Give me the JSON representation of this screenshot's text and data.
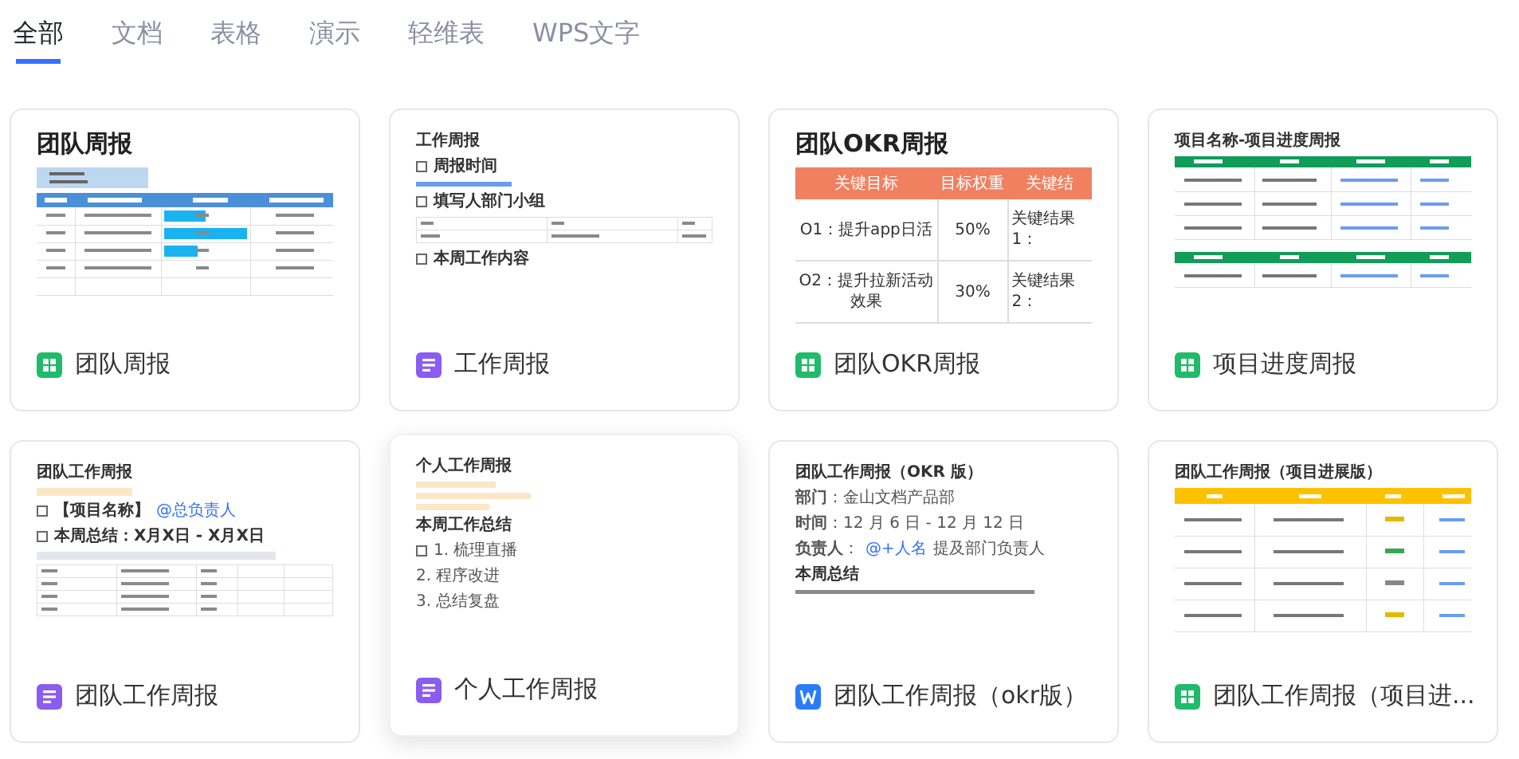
{
  "tabs": [
    {
      "label": "全部",
      "selected": true
    },
    {
      "label": "文档",
      "selected": false
    },
    {
      "label": "表格",
      "selected": false
    },
    {
      "label": "演示",
      "selected": false
    },
    {
      "label": "轻维表",
      "selected": false
    },
    {
      "label": "WPS文字",
      "selected": false
    }
  ],
  "cards": [
    {
      "name": "团队周报",
      "kind": "sheet",
      "hovered": false,
      "preview": [
        {
          "kind": "title",
          "text": "团队周报"
        },
        {
          "kind": "progress_table"
        }
      ]
    },
    {
      "name": "工作周报",
      "kind": "doc",
      "hovered": false,
      "preview": [
        {
          "kind": "subtitle",
          "text": "工作周报"
        },
        {
          "kind": "heading",
          "text": "周报时间",
          "box": true
        },
        {
          "kind": "blue_line"
        },
        {
          "kind": "heading",
          "text": "填写人部门小组",
          "box": true
        },
        {
          "kind": "small_table"
        },
        {
          "kind": "heading",
          "text": "本周工作内容",
          "box": true
        }
      ]
    },
    {
      "name": "团队OKR周报",
      "kind": "sheet",
      "hovered": false,
      "preview": [
        {
          "kind": "title",
          "text": "团队OKR周报"
        },
        {
          "kind": "table",
          "color": "#f08060",
          "columns": [
            "关键目标",
            "目标权重",
            "关键结"
          ],
          "rows": [
            [
              "O1：提升app日活",
              "50%",
              "关键结果1："
            ],
            [
              "O2：提升拉新活动效果",
              "30%",
              "关键结果2："
            ]
          ]
        }
      ]
    },
    {
      "name": "项目进度周报",
      "kind": "sheet",
      "hovered": false,
      "preview": [
        {
          "kind": "subtitle",
          "text": "项目名称-项目进度周报"
        },
        {
          "kind": "green_tables"
        }
      ]
    },
    {
      "name": "团队工作周报",
      "kind": "doc",
      "hovered": false,
      "preview": [
        {
          "kind": "subtitle",
          "text": "团队工作周报"
        },
        {
          "kind": "highlight_bar"
        },
        {
          "kind": "heading",
          "text": "【项目名称】",
          "link": "@总负责人",
          "box": true
        },
        {
          "kind": "heading",
          "text": "本周总结：X月X日 - X月X日",
          "box": true
        },
        {
          "kind": "grey_bar"
        },
        {
          "kind": "five_column_table"
        }
      ]
    },
    {
      "name": "个人工作周报",
      "kind": "doc",
      "hovered": true,
      "preview": [
        {
          "kind": "subtitle",
          "text": "个人工作周报"
        },
        {
          "kind": "highlight_bars"
        },
        {
          "kind": "heading",
          "text": "本周工作总结",
          "box": false
        },
        {
          "kind": "line",
          "text": "1. 梳理直播",
          "box": true
        },
        {
          "kind": "line",
          "text": "2. 程序改进",
          "box": false
        },
        {
          "kind": "line",
          "text": "3. 总结复盘",
          "box": false
        }
      ]
    },
    {
      "name": "团队工作周报（okr版）",
      "kind": "word",
      "hovered": false,
      "preview": [
        {
          "kind": "subtitle",
          "text": "团队工作周报（OKR 版）"
        },
        {
          "kind": "line",
          "text": "**部门**：金山文档产品部",
          "box": false
        },
        {
          "kind": "line",
          "text": "**时间**：12 月 6 日 - 12 月 12 日",
          "box": false
        },
        {
          "kind": "line",
          "text": "**负责人**：",
          "link": "@+人名",
          "after": "提及部门负责人",
          "box": false
        },
        {
          "kind": "heading",
          "text": "本周总结",
          "box": false
        },
        {
          "kind": "text_line"
        }
      ]
    },
    {
      "name": "团队工作周报（项目进...",
      "kind": "sheet",
      "hovered": false,
      "preview": [
        {
          "kind": "subtitle",
          "text": "团队工作周报（项目进展版）"
        },
        {
          "kind": "yellow_table"
        }
      ]
    }
  ]
}
